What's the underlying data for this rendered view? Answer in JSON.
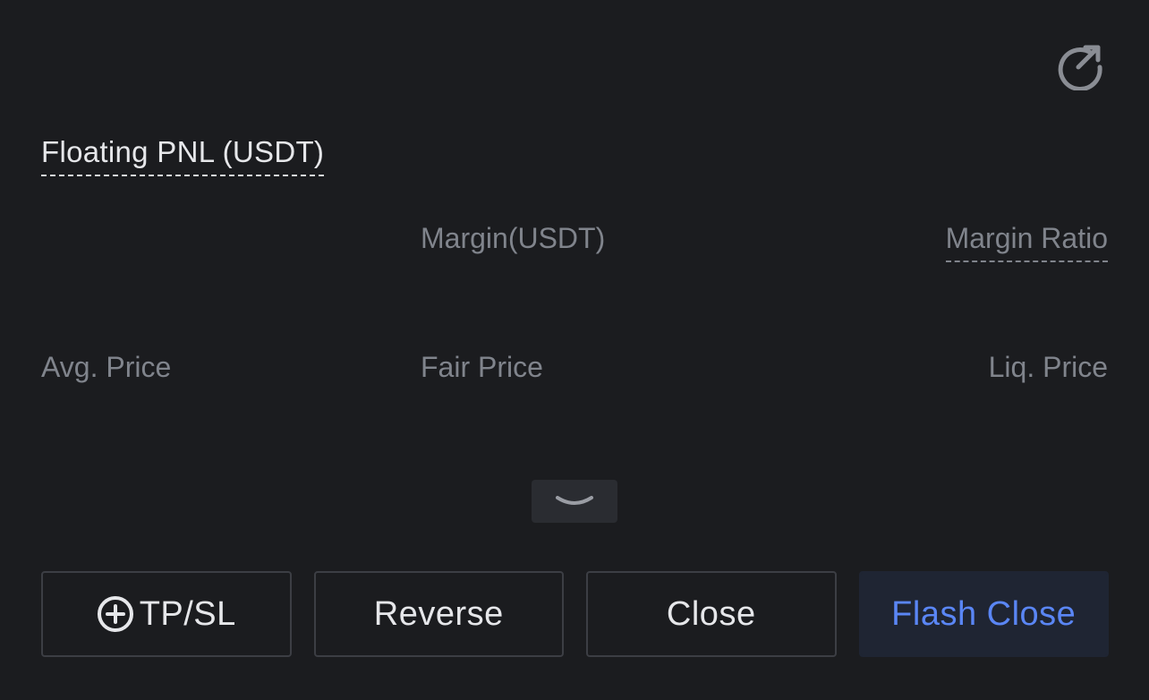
{
  "header": {
    "share_icon": "share-arrow-icon"
  },
  "pnl": {
    "label": "Floating PNL (USDT)"
  },
  "fields": {
    "margin_label": "Margin(USDT)",
    "margin_ratio_label": "Margin Ratio",
    "avg_price_label": "Avg. Price",
    "fair_price_label": "Fair Price",
    "liq_price_label": "Liq. Price"
  },
  "toggle": {
    "icon": "chevron-down-icon"
  },
  "actions": {
    "tpsl_label": "TP/SL",
    "tpsl_icon": "plus-circle-icon",
    "reverse_label": "Reverse",
    "close_label": "Close",
    "flash_close_label": "Flash Close"
  },
  "colors": {
    "background": "#1b1c1f",
    "text_primary": "#e6e7ea",
    "text_secondary": "#80848c",
    "accent": "#5a86f5",
    "flash_bg": "#1f2533"
  }
}
